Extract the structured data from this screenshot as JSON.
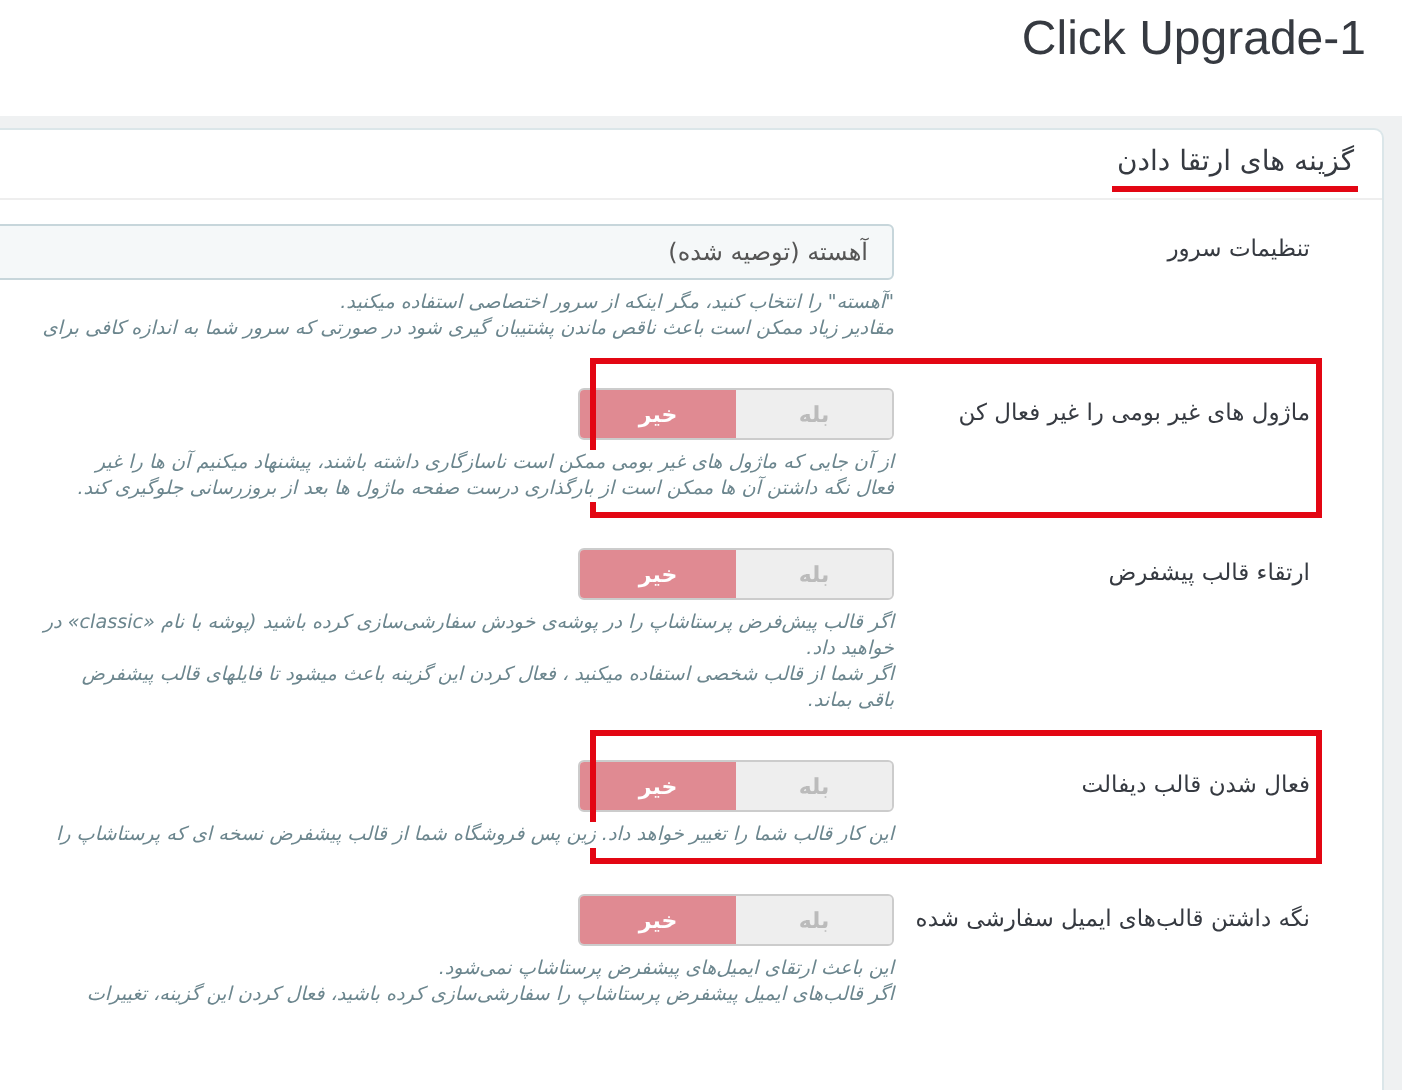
{
  "page": {
    "title": "Click Upgrade-1"
  },
  "panel": {
    "title": "گزینه های ارتقا دادن",
    "underlined": true,
    "rows": [
      {
        "kind": "select",
        "label": "تنظیمات سرور",
        "value": "آهسته (توصیه شده)",
        "highlighted": false,
        "help": [
          "\"آهسته\" را انتخاب کنید، مگر اینکه از سرور اختصاصی استفاده میکنید.",
          "مقادیر زیاد ممکن است باعث ناقص ماندن پشتیبان گیری شود در صورتی که سرور شما به اندازه کافی برای"
        ]
      },
      {
        "kind": "switch",
        "label": "ماژول های غیر بومی را غیر فعال کن",
        "highlighted": true,
        "options": [
          {
            "label": "بله",
            "selected": false
          },
          {
            "label": "خیر",
            "selected": true
          }
        ],
        "help": [
          "از آن جایی که ماژول های غیر بومی ممکن است ناسازگاری داشته باشند، پیشنهاد میکنیم آن ها را غیر",
          "فعال نگه داشتن آن ها ممکن است از بارگذاری درست صفحه ماژول ها بعد از بروزرسانی جلوگیری کند."
        ]
      },
      {
        "kind": "switch",
        "label": "ارتقاء قالب پیشفرض",
        "highlighted": false,
        "options": [
          {
            "label": "بله",
            "selected": false
          },
          {
            "label": "خیر",
            "selected": true
          }
        ],
        "help": [
          "اگر قالب پیش‌فرض پرستاشاپ را در پوشه‌ی خودش سفارشی‌سازی کرده باشید (پوشه با نام «classic» در",
          "خواهید داد.",
          "اگر شما از قالب شخصی استفاده میکنید ، فعال کردن این گزینه باعث میشود تا فایلهای قالب پیشفرض",
          "باقی بماند."
        ]
      },
      {
        "kind": "switch",
        "label": "فعال شدن قالب دیفالت",
        "highlighted": true,
        "options": [
          {
            "label": "بله",
            "selected": false
          },
          {
            "label": "خیر",
            "selected": true
          }
        ],
        "help": [
          "این کار قالب شما را تغییر خواهد داد. زین پس فروشگاه شما از قالب پیشفرض نسخه ای که پرستاشاپ را"
        ]
      },
      {
        "kind": "switch",
        "label": "نگه داشتن قالب‌های ایمیل سفارشی شده",
        "highlighted": false,
        "options": [
          {
            "label": "بله",
            "selected": false
          },
          {
            "label": "خیر",
            "selected": true
          }
        ],
        "help": [
          "این باعث ارتقای ایمیل‌های پیشفرض پرستاشاپ نمی‌شود.",
          "اگر قالب‌های ایمیل پیشفرض پرستاشاپ را سفارشی‌سازی کرده باشید، فعال کردن این گزینه، تغییرات"
        ]
      }
    ]
  }
}
